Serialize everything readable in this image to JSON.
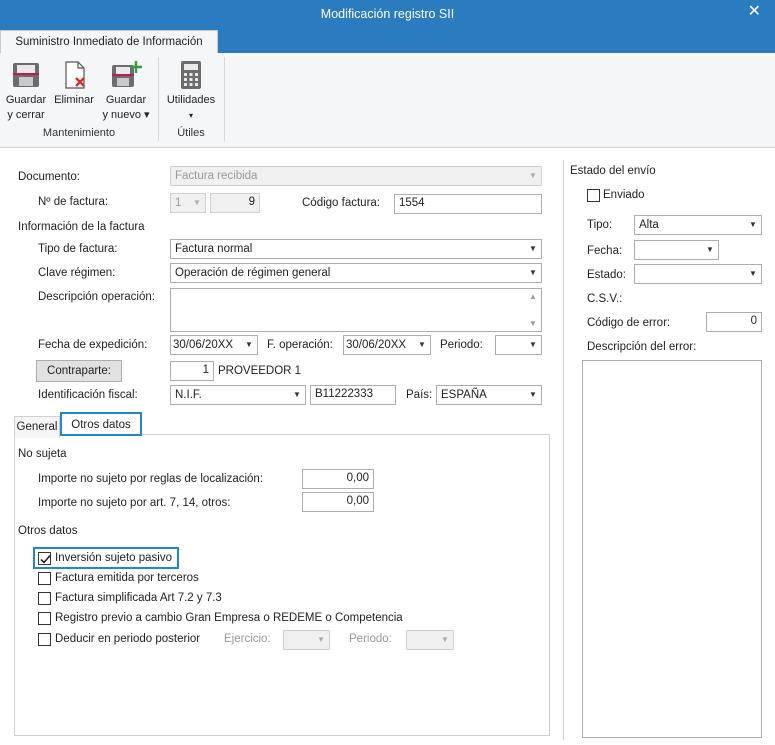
{
  "window": {
    "title": "Modificación registro SII",
    "close_glyph": "✕"
  },
  "ribbon": {
    "tab": "Suministro Inmediato de Información",
    "buttons": [
      {
        "line1": "Guardar",
        "line2": "y cerrar",
        "icon": "save-close-icon"
      },
      {
        "line1": "Eliminar",
        "line2": "",
        "icon": "delete-icon"
      },
      {
        "line1": "Guardar",
        "line2": "y nuevo ▾",
        "icon": "save-new-icon"
      },
      {
        "line1": "Utilidades",
        "line2": "▾",
        "icon": "calculator-icon"
      }
    ],
    "groups": {
      "mantenimiento": "Mantenimiento",
      "utiles": "Útiles"
    }
  },
  "form": {
    "documento_label": "Documento:",
    "documento_value": "Factura recibida",
    "num_factura_label": "Nº de factura:",
    "num_factura_serie": "1",
    "num_factura_value": "9",
    "codigo_factura_label": "Código factura:",
    "codigo_factura_value": "1554",
    "info_factura_heading": "Información de la factura",
    "tipo_factura_label": "Tipo de factura:",
    "tipo_factura_value": "Factura normal",
    "clave_regimen_label": "Clave régimen:",
    "clave_regimen_value": "Operación de régimen general",
    "descripcion_label": "Descripción operación:",
    "descripcion_value": "",
    "fecha_expedicion_label": "Fecha de expedición:",
    "fecha_expedicion_value": "30/06/20XX",
    "f_operacion_label": "F. operación:",
    "f_operacion_value": "30/06/20XX",
    "periodo_label": "Periodo:",
    "periodo_value": "",
    "contraparte_button": "Contraparte:",
    "contraparte_code": "1",
    "contraparte_name": "PROVEEDOR 1",
    "identificacion_label": "Identificación fiscal:",
    "identificacion_tipo": "N.I.F.",
    "identificacion_value": "B11222333",
    "pais_label": "País:",
    "pais_value": "ESPAÑA"
  },
  "tabs": {
    "general": "General",
    "otros": "Otros datos"
  },
  "otros_panel": {
    "no_sujeta_heading": "No sujeta",
    "importe_reglas_label": "Importe no sujeto por reglas de localización:",
    "importe_reglas_value": "0,00",
    "importe_art_label": "Importe no sujeto por art. 7, 14, otros:",
    "importe_art_value": "0,00",
    "otros_datos_heading": "Otros datos",
    "checkboxes": [
      {
        "label": "Inversión sujeto pasivo",
        "checked": true
      },
      {
        "label": "Factura emitida por terceros",
        "checked": false
      },
      {
        "label": "Factura simplificada Art 7.2 y 7.3",
        "checked": false
      },
      {
        "label": "Registro previo a cambio Gran Empresa o REDEME o Competencia",
        "checked": false
      },
      {
        "label": "Deducir en periodo posterior",
        "checked": false
      }
    ],
    "ejercicio_label": "Ejercicio:",
    "periodo_label": "Periodo:"
  },
  "estado_envio": {
    "heading": "Estado del envío",
    "enviado_label": "Enviado",
    "enviado_checked": false,
    "tipo_label": "Tipo:",
    "tipo_value": "Alta",
    "fecha_label": "Fecha:",
    "fecha_value": "",
    "estado_label": "Estado:",
    "estado_value": "",
    "csv_label": "C.S.V.:",
    "codigo_error_label": "Código de error:",
    "codigo_error_value": "0",
    "descripcion_error_label": "Descripción del error:",
    "descripcion_error_value": ""
  },
  "colors": {
    "accent": "#2b7bc0",
    "highlight": "#1e88c8"
  }
}
